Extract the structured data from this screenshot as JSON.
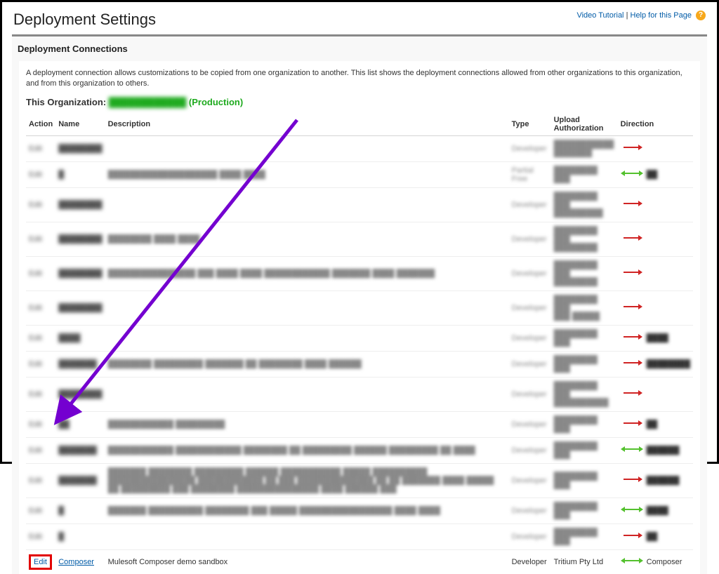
{
  "header": {
    "title": "Deployment Settings",
    "video_link": "Video Tutorial",
    "help_link": "Help for this Page"
  },
  "panel": {
    "title": "Deployment Connections",
    "intro": "A deployment connection allows customizations to be copied from one organization to another. This list shows the deployment connections allowed from other organizations to this organization, and from this organization to others.",
    "this_org_label": "This Organization:",
    "org_name": "████████████",
    "org_prod": "(Production)"
  },
  "columns": {
    "action": "Action",
    "name": "Name",
    "description": "Description",
    "type": "Type",
    "upload": "Upload Authorization",
    "direction": "Direction"
  },
  "rows": [
    {
      "action": "Edit",
      "name": "████████",
      "desc": "",
      "type": "Developer",
      "upload": "███████████\n███████",
      "dir_color": "red",
      "dir_txt": ""
    },
    {
      "action": "Edit",
      "name": "█",
      "desc": "████████████████████ ████ ████",
      "type": "Partial Free",
      "upload": "████████ ███",
      "dir_color": "green",
      "dir_txt": "██"
    },
    {
      "action": "Edit",
      "name": "████████",
      "desc": "",
      "type": "Developer",
      "upload": "████████ ███\n█████████",
      "dir_color": "red",
      "dir_txt": ""
    },
    {
      "action": "Edit",
      "name": "████████",
      "desc": "████████ ████ ████",
      "type": "Developer",
      "upload": "████████ ███\n████████",
      "dir_color": "red",
      "dir_txt": ""
    },
    {
      "action": "Edit",
      "name": "████████",
      "desc": "████████████████ ███ ████ ████ ████████████ ███████ ████ ███████",
      "type": "Developer",
      "upload": "████████ ███\n████████",
      "dir_color": "red",
      "dir_txt": ""
    },
    {
      "action": "Edit",
      "name": "████████",
      "desc": "",
      "type": "Developer",
      "upload": "████████ ███\n███ █████",
      "dir_color": "red",
      "dir_txt": ""
    },
    {
      "action": "Edit",
      "name": "████",
      "desc": "",
      "type": "Developer",
      "upload": "████████ ███",
      "dir_color": "red",
      "dir_txt": "████"
    },
    {
      "action": "Edit",
      "name": "███████",
      "desc": "████████ █████████ ███████ ██ ████████ ████ ██████",
      "type": "Developer",
      "upload": "████████ ███",
      "dir_color": "red",
      "dir_txt": "████████"
    },
    {
      "action": "Edit",
      "name": "████████",
      "desc": "",
      "type": "Developer",
      "upload": "████████ ███\n██████████",
      "dir_color": "red",
      "dir_txt": ""
    },
    {
      "action": "Edit",
      "name": "██",
      "desc": "████████████ █████████",
      "type": "Developer",
      "upload": "████████ ███",
      "dir_color": "red",
      "dir_txt": "██"
    },
    {
      "action": "Edit",
      "name": "███████",
      "desc": "████████████ ████████████ ████████ ██ █████████ ██████ █████████ ██ ████",
      "type": "Developer",
      "upload": "████████ ███",
      "dir_color": "green",
      "dir_txt": "██████"
    },
    {
      "action": "Edit",
      "name": "███████",
      "desc": "███████ ████████ █████████ ██████ ███████████ █████ ██████████ ████████████████ ████████████ ██ ███ ██████████████ ██ ██\n███████ ████ █████ ██ █████████ ███ ████████ ███████████████ ████ ██████ ███",
      "type": "Developer",
      "upload": "████████ ███",
      "dir_color": "red",
      "dir_txt": "██████"
    },
    {
      "action": "Edit",
      "name": "█",
      "desc": "███████ ██████████ ████████ ███ █████ █████████████████ ████ ████",
      "type": "Developer",
      "upload": "████████ ███",
      "dir_color": "green",
      "dir_txt": "████"
    },
    {
      "action": "Edit",
      "name": "█",
      "desc": "",
      "type": "Developer",
      "upload": "████████ ███",
      "dir_color": "red",
      "dir_txt": "██"
    }
  ],
  "focus_row": {
    "action": "Edit",
    "name": "Composer",
    "desc": "Mulesoft Composer demo sandbox",
    "type": "Developer",
    "upload": "Tritium Pty Ltd",
    "direction": "Composer",
    "dir_color": "green"
  }
}
